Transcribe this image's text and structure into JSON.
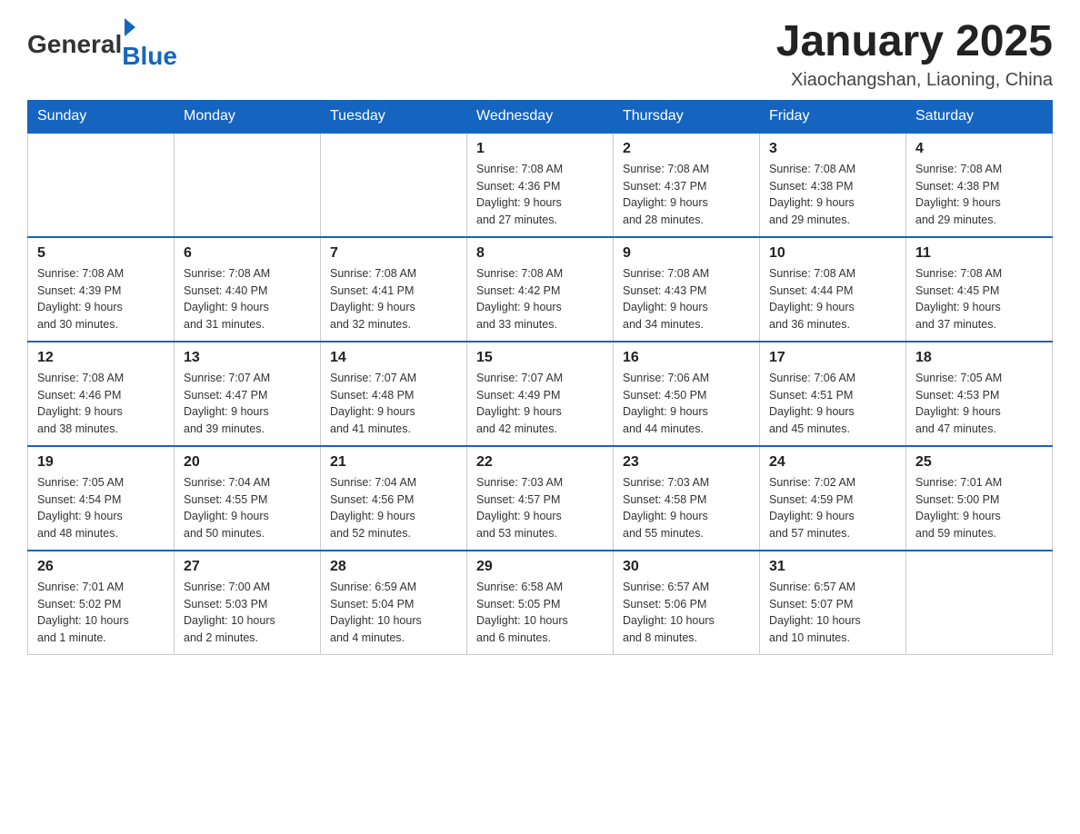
{
  "logo": {
    "general": "General",
    "blue": "Blue"
  },
  "header": {
    "title": "January 2025",
    "subtitle": "Xiaochangshan, Liaoning, China"
  },
  "weekdays": [
    "Sunday",
    "Monday",
    "Tuesday",
    "Wednesday",
    "Thursday",
    "Friday",
    "Saturday"
  ],
  "weeks": [
    [
      {
        "day": "",
        "info": ""
      },
      {
        "day": "",
        "info": ""
      },
      {
        "day": "",
        "info": ""
      },
      {
        "day": "1",
        "info": "Sunrise: 7:08 AM\nSunset: 4:36 PM\nDaylight: 9 hours\nand 27 minutes."
      },
      {
        "day": "2",
        "info": "Sunrise: 7:08 AM\nSunset: 4:37 PM\nDaylight: 9 hours\nand 28 minutes."
      },
      {
        "day": "3",
        "info": "Sunrise: 7:08 AM\nSunset: 4:38 PM\nDaylight: 9 hours\nand 29 minutes."
      },
      {
        "day": "4",
        "info": "Sunrise: 7:08 AM\nSunset: 4:38 PM\nDaylight: 9 hours\nand 29 minutes."
      }
    ],
    [
      {
        "day": "5",
        "info": "Sunrise: 7:08 AM\nSunset: 4:39 PM\nDaylight: 9 hours\nand 30 minutes."
      },
      {
        "day": "6",
        "info": "Sunrise: 7:08 AM\nSunset: 4:40 PM\nDaylight: 9 hours\nand 31 minutes."
      },
      {
        "day": "7",
        "info": "Sunrise: 7:08 AM\nSunset: 4:41 PM\nDaylight: 9 hours\nand 32 minutes."
      },
      {
        "day": "8",
        "info": "Sunrise: 7:08 AM\nSunset: 4:42 PM\nDaylight: 9 hours\nand 33 minutes."
      },
      {
        "day": "9",
        "info": "Sunrise: 7:08 AM\nSunset: 4:43 PM\nDaylight: 9 hours\nand 34 minutes."
      },
      {
        "day": "10",
        "info": "Sunrise: 7:08 AM\nSunset: 4:44 PM\nDaylight: 9 hours\nand 36 minutes."
      },
      {
        "day": "11",
        "info": "Sunrise: 7:08 AM\nSunset: 4:45 PM\nDaylight: 9 hours\nand 37 minutes."
      }
    ],
    [
      {
        "day": "12",
        "info": "Sunrise: 7:08 AM\nSunset: 4:46 PM\nDaylight: 9 hours\nand 38 minutes."
      },
      {
        "day": "13",
        "info": "Sunrise: 7:07 AM\nSunset: 4:47 PM\nDaylight: 9 hours\nand 39 minutes."
      },
      {
        "day": "14",
        "info": "Sunrise: 7:07 AM\nSunset: 4:48 PM\nDaylight: 9 hours\nand 41 minutes."
      },
      {
        "day": "15",
        "info": "Sunrise: 7:07 AM\nSunset: 4:49 PM\nDaylight: 9 hours\nand 42 minutes."
      },
      {
        "day": "16",
        "info": "Sunrise: 7:06 AM\nSunset: 4:50 PM\nDaylight: 9 hours\nand 44 minutes."
      },
      {
        "day": "17",
        "info": "Sunrise: 7:06 AM\nSunset: 4:51 PM\nDaylight: 9 hours\nand 45 minutes."
      },
      {
        "day": "18",
        "info": "Sunrise: 7:05 AM\nSunset: 4:53 PM\nDaylight: 9 hours\nand 47 minutes."
      }
    ],
    [
      {
        "day": "19",
        "info": "Sunrise: 7:05 AM\nSunset: 4:54 PM\nDaylight: 9 hours\nand 48 minutes."
      },
      {
        "day": "20",
        "info": "Sunrise: 7:04 AM\nSunset: 4:55 PM\nDaylight: 9 hours\nand 50 minutes."
      },
      {
        "day": "21",
        "info": "Sunrise: 7:04 AM\nSunset: 4:56 PM\nDaylight: 9 hours\nand 52 minutes."
      },
      {
        "day": "22",
        "info": "Sunrise: 7:03 AM\nSunset: 4:57 PM\nDaylight: 9 hours\nand 53 minutes."
      },
      {
        "day": "23",
        "info": "Sunrise: 7:03 AM\nSunset: 4:58 PM\nDaylight: 9 hours\nand 55 minutes."
      },
      {
        "day": "24",
        "info": "Sunrise: 7:02 AM\nSunset: 4:59 PM\nDaylight: 9 hours\nand 57 minutes."
      },
      {
        "day": "25",
        "info": "Sunrise: 7:01 AM\nSunset: 5:00 PM\nDaylight: 9 hours\nand 59 minutes."
      }
    ],
    [
      {
        "day": "26",
        "info": "Sunrise: 7:01 AM\nSunset: 5:02 PM\nDaylight: 10 hours\nand 1 minute."
      },
      {
        "day": "27",
        "info": "Sunrise: 7:00 AM\nSunset: 5:03 PM\nDaylight: 10 hours\nand 2 minutes."
      },
      {
        "day": "28",
        "info": "Sunrise: 6:59 AM\nSunset: 5:04 PM\nDaylight: 10 hours\nand 4 minutes."
      },
      {
        "day": "29",
        "info": "Sunrise: 6:58 AM\nSunset: 5:05 PM\nDaylight: 10 hours\nand 6 minutes."
      },
      {
        "day": "30",
        "info": "Sunrise: 6:57 AM\nSunset: 5:06 PM\nDaylight: 10 hours\nand 8 minutes."
      },
      {
        "day": "31",
        "info": "Sunrise: 6:57 AM\nSunset: 5:07 PM\nDaylight: 10 hours\nand 10 minutes."
      },
      {
        "day": "",
        "info": ""
      }
    ]
  ]
}
